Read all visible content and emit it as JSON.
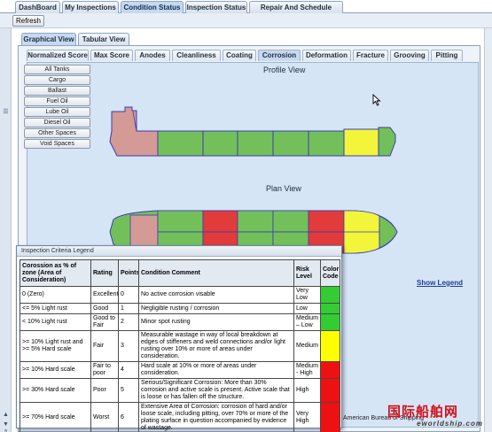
{
  "top_tabs": [
    "DashBoard",
    "My Inspections",
    "Condition Status",
    "Inspection Status",
    "Repair And Schedule Status"
  ],
  "toolbar": {
    "refresh_label": "Refresh"
  },
  "view_tabs": [
    "Graphical View",
    "Tabular View"
  ],
  "sub_tabs": [
    "Normalized Score",
    "Max Score",
    "Anodes",
    "Cleanliness",
    "Coating",
    "Corrosion",
    "Deformation",
    "Fracture",
    "Grooving",
    "Pitting"
  ],
  "space_filters": [
    "All Tanks",
    "Cargo",
    "Ballast",
    "Fuel Oil",
    "Lube Oil",
    "Diesel Oil",
    "Other Spaces",
    "Void Spaces"
  ],
  "profile_view_title": "Profile View",
  "plan_view_title": "Plan View",
  "show_legend_label": "Show Legend",
  "footer_text": "American Bureau of Shipping",
  "watermark": {
    "cn": "国际船舶网",
    "en": "eworldship.com"
  },
  "legend": {
    "title": "Inspection Criteria Legend",
    "headers": {
      "corrosion": "Corossion as % of zone (Area of Consideration)",
      "rating": "Rating",
      "points": "Points",
      "comment": "Condition Comment",
      "risk": "Risk Level",
      "color": "Color Code"
    },
    "rows": [
      {
        "corrosion": "0 (Zero)",
        "rating": "Excellent",
        "points": "0",
        "comment": "No active corrosion visable",
        "risk": "Very Low",
        "color": "#33cc33"
      },
      {
        "corrosion": "<= 5% Light rust",
        "rating": "Good",
        "points": "1",
        "comment": "Negligible rusting / corrosion",
        "risk": "Low",
        "color": "#33cc33"
      },
      {
        "corrosion": "< 10% Light rust",
        "rating": "Good to Fair",
        "points": "2",
        "comment": "Minor spot rusting",
        "risk": "Medium – Low",
        "color": "#33cc33"
      },
      {
        "corrosion": ">= 10% Light rust and >= 5% Hard scale",
        "rating": "Fair",
        "points": "3",
        "comment": "Measurable wastage in way of local breakdown at edges of stiffeners and weld connections and/or light rusting over 10% or more of areas under consideration.",
        "risk": "Medium",
        "color": "#ffff00"
      },
      {
        "corrosion": ">= 10% Hard scale",
        "rating": "Fair to poor",
        "points": "4",
        "comment": "Hard scale at 10% or more of areas under consideration.",
        "risk": "Medium - High",
        "color": "#ee1111"
      },
      {
        "corrosion": ">= 30% Hard scale",
        "rating": "Poor",
        "points": "5",
        "comment": "Serious/Significant Corrosion: More than 30% corrosion and active scale is present. Active scale that is loose or has fallen off the structure.",
        "risk": "High",
        "color": "#ee1111"
      },
      {
        "corrosion": ">= 70% Hard scale",
        "rating": "Worst",
        "points": "6",
        "comment": "Extensive Area of Corrosion: corrosion of hard and/or loose scale, including pitting, over 70% or more of the plating surface in question accompanied by evidence of wastage.",
        "risk": "Very High",
        "color": "#ee1111"
      }
    ]
  },
  "colors": {
    "good": "#73c05a",
    "fair": "#f2f53a",
    "poor": "#e23b3b",
    "superstructure": "#d49a96",
    "hull_outline": "#3b3bb0"
  }
}
